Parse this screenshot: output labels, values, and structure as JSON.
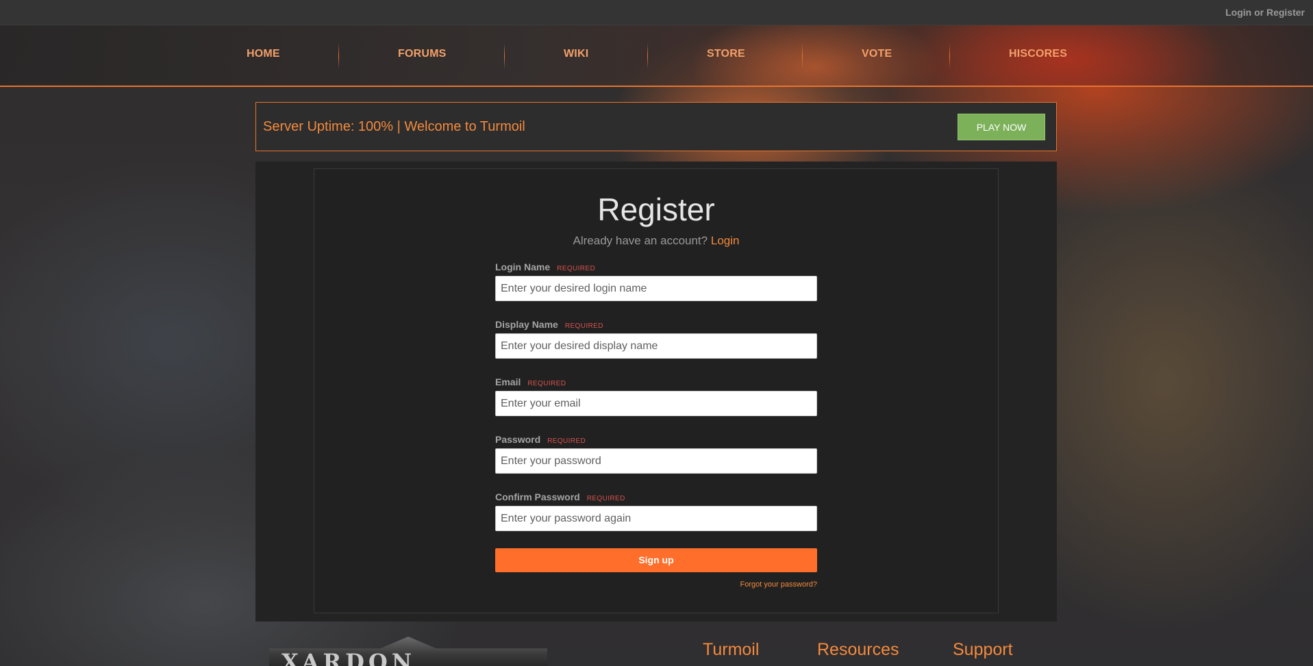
{
  "top_bar": {
    "auth_link": "Login or Register"
  },
  "nav": {
    "items": [
      {
        "label": "HOME"
      },
      {
        "label": "FORUMS"
      },
      {
        "label": "WIKI"
      },
      {
        "label": "STORE"
      },
      {
        "label": "VOTE"
      },
      {
        "label": "HISCORES"
      }
    ]
  },
  "banner": {
    "message": "Server Uptime: 100% | Welcome to Turmoil",
    "play_button": "PLAY NOW"
  },
  "register": {
    "title": "Register",
    "already_text": "Already have an account?",
    "login_link": "Login",
    "required_tag": "REQUIRED",
    "fields": [
      {
        "label": "Login Name",
        "placeholder": "Enter your desired login name",
        "value": ""
      },
      {
        "label": "Display Name",
        "placeholder": "Enter your desired display name",
        "value": ""
      },
      {
        "label": "Email",
        "placeholder": "Enter your email",
        "value": ""
      },
      {
        "label": "Password",
        "placeholder": "Enter your password",
        "value": ""
      },
      {
        "label": "Confirm Password",
        "placeholder": "Enter your password again",
        "value": ""
      }
    ],
    "submit": "Sign up",
    "forgot": "Forgot your password?"
  },
  "footer": {
    "logo_text": "XARDON",
    "headings": [
      "Turmoil",
      "Resources",
      "Support"
    ]
  },
  "colors": {
    "accent": "#f48a3d",
    "signup": "#ff6e2b",
    "play": "#7cb15a",
    "required": "#d9534f",
    "background": "#2c2c2e"
  }
}
